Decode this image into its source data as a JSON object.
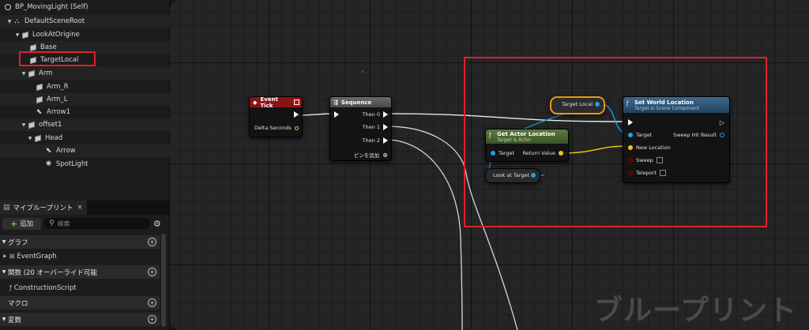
{
  "tree": {
    "root": "BP_MovingLight (Self)",
    "items": [
      {
        "label": "DefaultSceneRoot",
        "icon": "scene-root-icon"
      },
      {
        "label": "LookAtOrigine",
        "icon": "component-cube-icon"
      },
      {
        "label": "Base",
        "icon": "component-cube-icon"
      },
      {
        "label": "TargetLocal",
        "icon": "component-cube-icon"
      },
      {
        "label": "Arm",
        "icon": "component-cube-icon"
      },
      {
        "label": "Arm_R",
        "icon": "component-cube-icon"
      },
      {
        "label": "Arm_L",
        "icon": "component-cube-icon"
      },
      {
        "label": "Arrow1",
        "icon": "arrow-component-icon"
      },
      {
        "label": "offset1",
        "icon": "component-cube-icon"
      },
      {
        "label": "Head",
        "icon": "component-cube-icon"
      },
      {
        "label": "Arrow",
        "icon": "arrow-component-icon"
      },
      {
        "label": "SpotLight",
        "icon": "spotlight-icon"
      }
    ]
  },
  "my_blueprint": {
    "tab_label": "マイブループリント",
    "close": "×",
    "add_label": "追加",
    "search_placeholder": "検索",
    "categories": {
      "graph": "グラフ",
      "event_graph": "EventGraph",
      "functions": "関数 (20 オーバーライド可能",
      "construction": "ConstructionScript",
      "macros": "マクロ",
      "variables": "変数"
    }
  },
  "graph": {
    "watermark": "ブループリント",
    "nodes": {
      "event_tick": {
        "title": "Event Tick",
        "pin_delta": "Delta Seconds"
      },
      "sequence": {
        "title": "Sequence",
        "then0": "Then 0",
        "then1": "Then 1",
        "then2": "Then 2",
        "add_pin": "ピンを追加"
      },
      "target_local": {
        "title": "Target Local"
      },
      "get_actor_location": {
        "title": "Get Actor Location",
        "subtitle": "Target is Actor",
        "pin_target": "Target",
        "pin_return": "Return Value"
      },
      "look_at_target": {
        "title": "Look at Target"
      },
      "set_world_location": {
        "title": "Set World Location",
        "subtitle": "Target is Scene Component",
        "pin_target": "Target",
        "pin_sweep_hit": "Sweep Hit Result",
        "pin_new_location": "New Location",
        "pin_sweep": "Sweep",
        "pin_teleport": "Teleport"
      }
    }
  },
  "colors": {
    "event_header": "#8a1318",
    "sequence_header": "#5a5a5a",
    "function_header": "#2c4f6e",
    "pure_header": "#4a6b33",
    "object_pin": "#1aa0e8",
    "vector_pin": "#f5c21a",
    "float_pin": "#9bf04a",
    "bool_pin": "#8a0000",
    "highlight": "#e0202a"
  }
}
